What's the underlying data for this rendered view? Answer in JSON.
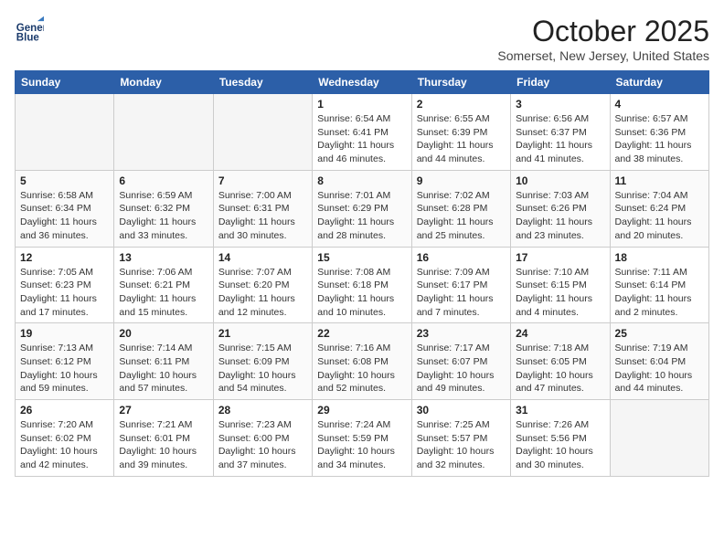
{
  "header": {
    "logo_line1": "General",
    "logo_line2": "Blue",
    "month": "October 2025",
    "location": "Somerset, New Jersey, United States"
  },
  "weekdays": [
    "Sunday",
    "Monday",
    "Tuesday",
    "Wednesday",
    "Thursday",
    "Friday",
    "Saturday"
  ],
  "weeks": [
    [
      {
        "day": "",
        "info": ""
      },
      {
        "day": "",
        "info": ""
      },
      {
        "day": "",
        "info": ""
      },
      {
        "day": "1",
        "info": "Sunrise: 6:54 AM\nSunset: 6:41 PM\nDaylight: 11 hours\nand 46 minutes."
      },
      {
        "day": "2",
        "info": "Sunrise: 6:55 AM\nSunset: 6:39 PM\nDaylight: 11 hours\nand 44 minutes."
      },
      {
        "day": "3",
        "info": "Sunrise: 6:56 AM\nSunset: 6:37 PM\nDaylight: 11 hours\nand 41 minutes."
      },
      {
        "day": "4",
        "info": "Sunrise: 6:57 AM\nSunset: 6:36 PM\nDaylight: 11 hours\nand 38 minutes."
      }
    ],
    [
      {
        "day": "5",
        "info": "Sunrise: 6:58 AM\nSunset: 6:34 PM\nDaylight: 11 hours\nand 36 minutes."
      },
      {
        "day": "6",
        "info": "Sunrise: 6:59 AM\nSunset: 6:32 PM\nDaylight: 11 hours\nand 33 minutes."
      },
      {
        "day": "7",
        "info": "Sunrise: 7:00 AM\nSunset: 6:31 PM\nDaylight: 11 hours\nand 30 minutes."
      },
      {
        "day": "8",
        "info": "Sunrise: 7:01 AM\nSunset: 6:29 PM\nDaylight: 11 hours\nand 28 minutes."
      },
      {
        "day": "9",
        "info": "Sunrise: 7:02 AM\nSunset: 6:28 PM\nDaylight: 11 hours\nand 25 minutes."
      },
      {
        "day": "10",
        "info": "Sunrise: 7:03 AM\nSunset: 6:26 PM\nDaylight: 11 hours\nand 23 minutes."
      },
      {
        "day": "11",
        "info": "Sunrise: 7:04 AM\nSunset: 6:24 PM\nDaylight: 11 hours\nand 20 minutes."
      }
    ],
    [
      {
        "day": "12",
        "info": "Sunrise: 7:05 AM\nSunset: 6:23 PM\nDaylight: 11 hours\nand 17 minutes."
      },
      {
        "day": "13",
        "info": "Sunrise: 7:06 AM\nSunset: 6:21 PM\nDaylight: 11 hours\nand 15 minutes."
      },
      {
        "day": "14",
        "info": "Sunrise: 7:07 AM\nSunset: 6:20 PM\nDaylight: 11 hours\nand 12 minutes."
      },
      {
        "day": "15",
        "info": "Sunrise: 7:08 AM\nSunset: 6:18 PM\nDaylight: 11 hours\nand 10 minutes."
      },
      {
        "day": "16",
        "info": "Sunrise: 7:09 AM\nSunset: 6:17 PM\nDaylight: 11 hours\nand 7 minutes."
      },
      {
        "day": "17",
        "info": "Sunrise: 7:10 AM\nSunset: 6:15 PM\nDaylight: 11 hours\nand 4 minutes."
      },
      {
        "day": "18",
        "info": "Sunrise: 7:11 AM\nSunset: 6:14 PM\nDaylight: 11 hours\nand 2 minutes."
      }
    ],
    [
      {
        "day": "19",
        "info": "Sunrise: 7:13 AM\nSunset: 6:12 PM\nDaylight: 10 hours\nand 59 minutes."
      },
      {
        "day": "20",
        "info": "Sunrise: 7:14 AM\nSunset: 6:11 PM\nDaylight: 10 hours\nand 57 minutes."
      },
      {
        "day": "21",
        "info": "Sunrise: 7:15 AM\nSunset: 6:09 PM\nDaylight: 10 hours\nand 54 minutes."
      },
      {
        "day": "22",
        "info": "Sunrise: 7:16 AM\nSunset: 6:08 PM\nDaylight: 10 hours\nand 52 minutes."
      },
      {
        "day": "23",
        "info": "Sunrise: 7:17 AM\nSunset: 6:07 PM\nDaylight: 10 hours\nand 49 minutes."
      },
      {
        "day": "24",
        "info": "Sunrise: 7:18 AM\nSunset: 6:05 PM\nDaylight: 10 hours\nand 47 minutes."
      },
      {
        "day": "25",
        "info": "Sunrise: 7:19 AM\nSunset: 6:04 PM\nDaylight: 10 hours\nand 44 minutes."
      }
    ],
    [
      {
        "day": "26",
        "info": "Sunrise: 7:20 AM\nSunset: 6:02 PM\nDaylight: 10 hours\nand 42 minutes."
      },
      {
        "day": "27",
        "info": "Sunrise: 7:21 AM\nSunset: 6:01 PM\nDaylight: 10 hours\nand 39 minutes."
      },
      {
        "day": "28",
        "info": "Sunrise: 7:23 AM\nSunset: 6:00 PM\nDaylight: 10 hours\nand 37 minutes."
      },
      {
        "day": "29",
        "info": "Sunrise: 7:24 AM\nSunset: 5:59 PM\nDaylight: 10 hours\nand 34 minutes."
      },
      {
        "day": "30",
        "info": "Sunrise: 7:25 AM\nSunset: 5:57 PM\nDaylight: 10 hours\nand 32 minutes."
      },
      {
        "day": "31",
        "info": "Sunrise: 7:26 AM\nSunset: 5:56 PM\nDaylight: 10 hours\nand 30 minutes."
      },
      {
        "day": "",
        "info": ""
      }
    ]
  ]
}
